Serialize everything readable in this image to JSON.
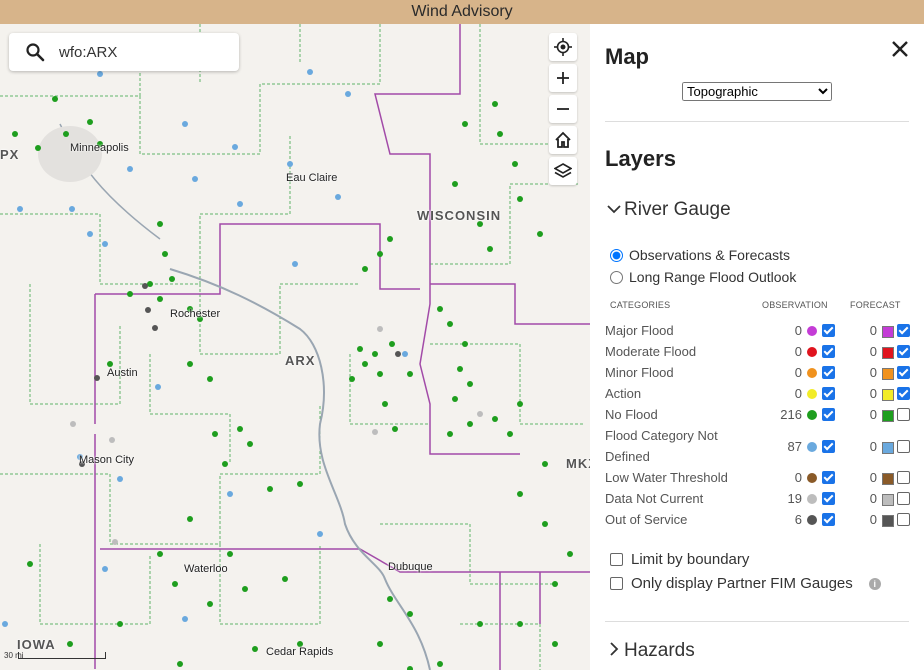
{
  "banner": {
    "text": "Wind Advisory"
  },
  "search": {
    "value": "wfo:ARX",
    "placeholder": ""
  },
  "map": {
    "cities": [
      "Minneapolis",
      "Eau Claire",
      "Rochester",
      "Austin",
      "Mason City",
      "Waterloo",
      "Dubuque",
      "Cedar Rapids"
    ],
    "states": [
      "WISCONSIN",
      "IOWA"
    ],
    "offices": [
      "ARX",
      "MKX",
      "PX"
    ],
    "scale": "30 mi",
    "controls": [
      "locate-icon",
      "zoom-in-icon",
      "zoom-out-icon",
      "home-icon",
      "layers-icon"
    ]
  },
  "panel": {
    "title": "Map",
    "basemap": {
      "selected": "Topographic",
      "options": [
        "Topographic"
      ]
    },
    "layers_heading": "Layers",
    "river_gauge": {
      "title": "River Gauge",
      "radio_options": [
        "Observations & Forecasts",
        "Long Range Flood Outlook"
      ],
      "selected_radio": "Observations & Forecasts",
      "col_categories": "CATEGORIES",
      "col_observation": "OBSERVATION",
      "col_forecast": "FORECAST",
      "categories": [
        {
          "label": "Major Flood",
          "obs": "0",
          "color": "#c43cd6",
          "obs_checked": true,
          "fc": "0",
          "fc_checked": true
        },
        {
          "label": "Moderate Flood",
          "obs": "0",
          "color": "#e0141e",
          "obs_checked": true,
          "fc": "0",
          "fc_checked": true
        },
        {
          "label": "Minor Flood",
          "obs": "0",
          "color": "#f0921e",
          "obs_checked": true,
          "fc": "0",
          "fc_checked": true
        },
        {
          "label": "Action",
          "obs": "0",
          "color": "#f2ec28",
          "obs_checked": true,
          "fc": "0",
          "fc_checked": true
        },
        {
          "label": "No Flood",
          "obs": "216",
          "color": "#1e9e1e",
          "obs_checked": true,
          "fc": "0",
          "fc_checked": false
        },
        {
          "label": "Flood Category Not",
          "label2": "Defined",
          "obs": "87",
          "color": "#6aa9de",
          "obs_checked": true,
          "fc": "0",
          "fc_checked": false
        },
        {
          "label": "Low Water Threshold",
          "obs": "0",
          "color": "#8a5a28",
          "obs_checked": true,
          "fc": "0",
          "fc_checked": false
        },
        {
          "label": "Data Not Current",
          "obs": "19",
          "color": "#bdbdbd",
          "obs_checked": true,
          "fc": "0",
          "fc_checked": false
        },
        {
          "label": "Out of Service",
          "obs": "6",
          "color": "#555555",
          "obs_checked": true,
          "fc": "0",
          "fc_checked": false
        }
      ],
      "limit_by_boundary": "Limit by boundary",
      "partner_fim": "Only display Partner FIM Gauges"
    },
    "hazards": "Hazards"
  }
}
